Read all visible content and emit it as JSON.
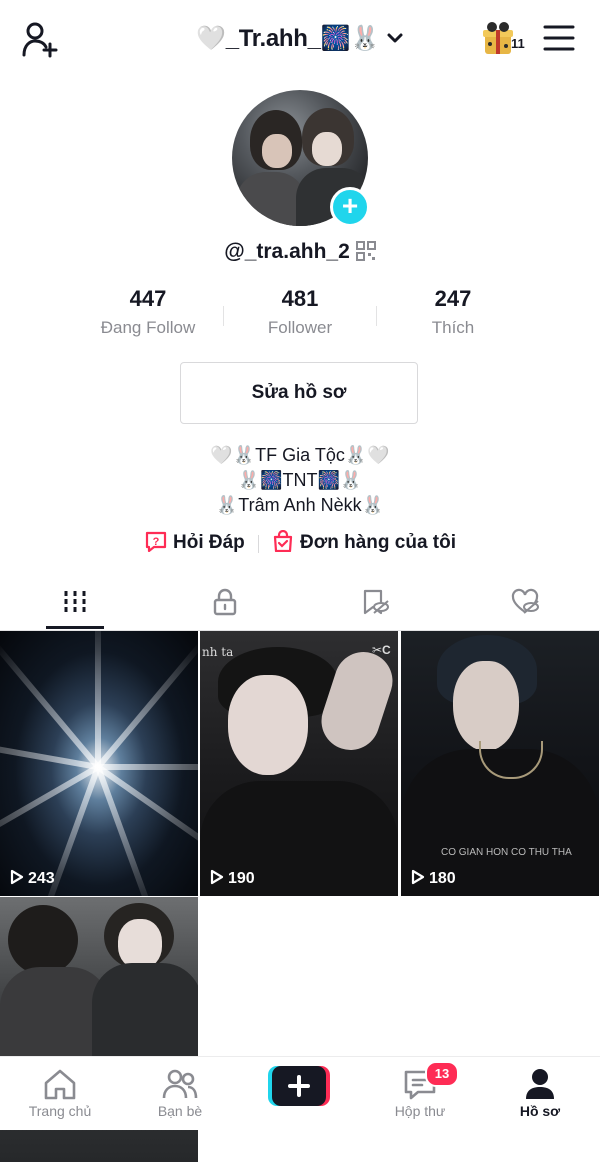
{
  "header": {
    "username": "🤍_Tr.ahh_🎆🐰",
    "gift_count": "11"
  },
  "profile": {
    "handle": "@_tra.ahh_2",
    "stats": [
      {
        "value": "447",
        "label": "Đang Follow"
      },
      {
        "value": "481",
        "label": "Follower"
      },
      {
        "value": "247",
        "label": "Thích"
      }
    ],
    "edit_label": "Sửa hồ sơ",
    "bio": [
      "🤍🐰TF Gia Tộc🐰🤍",
      "🐰🎆TNT🎆🐰",
      "🐰Trâm Anh Nèkk🐰"
    ],
    "links": {
      "qa": "Hỏi Đáp",
      "orders": "Đơn hàng của tôi"
    }
  },
  "tabs": [
    "videos-icon",
    "lock-icon",
    "hidden-like-icon",
    "favorites-icon"
  ],
  "videos": [
    {
      "views": "243"
    },
    {
      "views": "190",
      "caption_left": "nh ta",
      "caption_right": "✂C"
    },
    {
      "views": "180",
      "caption": "CO GIAN HON CO THU THA"
    },
    {
      "views": ""
    }
  ],
  "nav": {
    "home": "Trang chủ",
    "friends": "Bạn bè",
    "inbox": "Hộp thư",
    "inbox_badge": "13",
    "profile": "Hồ sơ"
  },
  "colors": {
    "accent": "#fe2c55",
    "teal": "#20d5ec",
    "text": "#161823",
    "muted": "#8a8b91"
  }
}
